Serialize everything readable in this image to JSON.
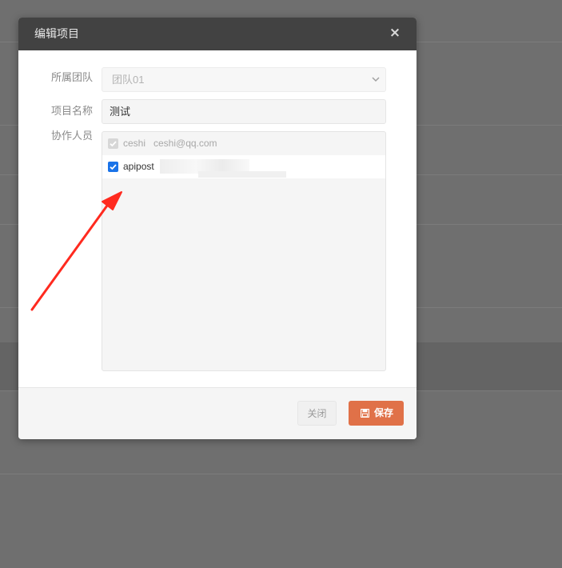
{
  "modal": {
    "title": "编辑项目",
    "close_icon": "×"
  },
  "form": {
    "team_label": "所属团队",
    "team_value": "团队01",
    "name_label": "项目名称",
    "name_value": "测试",
    "members_label": "协作人员",
    "members": [
      {
        "name": "ceshi",
        "email": "ceshi@qq.com",
        "checked": true,
        "disabled": true
      },
      {
        "name": "apipost",
        "email": "",
        "checked": true,
        "disabled": false
      }
    ]
  },
  "footer": {
    "close_label": "关闭",
    "save_label": "保存"
  },
  "colors": {
    "header_bg": "#424242",
    "save_button": "#e07148",
    "checkbox_checked": "#1a73e8",
    "annotation_arrow": "#ff2a1f",
    "backdrop": "#6f6f6f"
  },
  "icons": {
    "close": "close-icon",
    "select": "chevron-down-icon",
    "save": "floppy-disk-icon",
    "checkbox": "checkmark-icon",
    "annotation": "red-arrow-annotation"
  }
}
